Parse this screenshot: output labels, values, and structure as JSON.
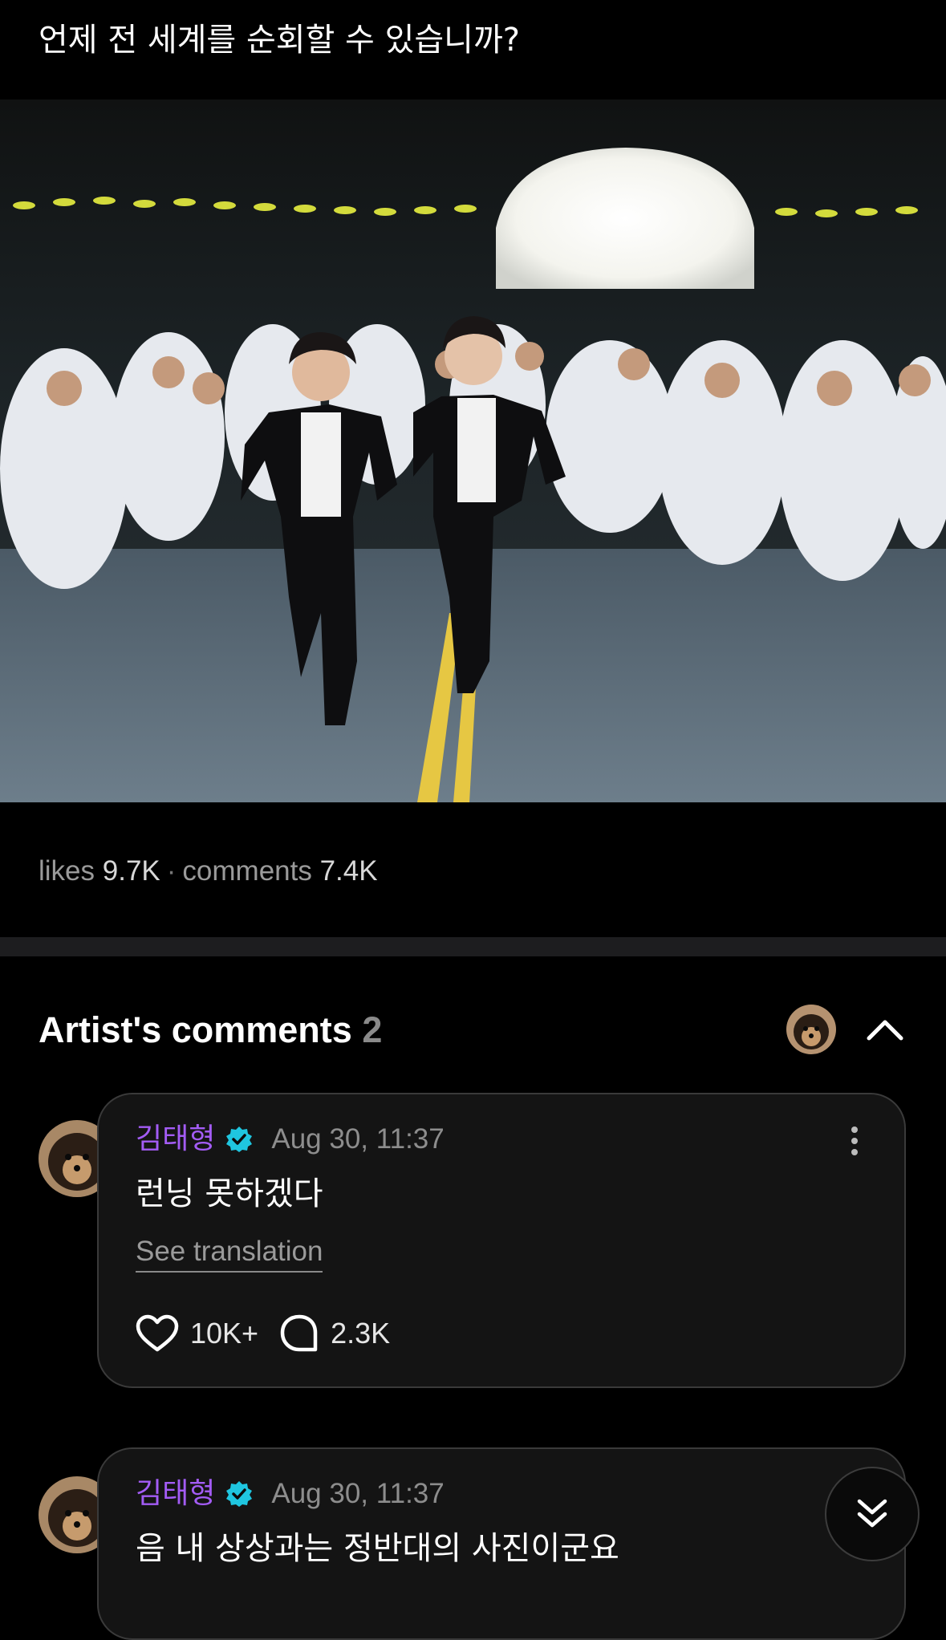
{
  "post": {
    "text": "언제 전 세계를 순회할 수 있습니까?"
  },
  "stats": {
    "likes_label": "likes",
    "likes_value": "9.7K",
    "separator": "·",
    "comments_label": "comments",
    "comments_value": "7.4K"
  },
  "artist_comments": {
    "title": "Artist's comments",
    "count": "2"
  },
  "comments": [
    {
      "author": "김태형",
      "time": "Aug 30, 11:37",
      "text": "런닝 못하겠다",
      "translate_label": "See translation",
      "likes": "10K+",
      "replies": "2.3K"
    },
    {
      "author": "김태형",
      "time": "Aug 30, 11:37",
      "text": "음 내 상상과는 정반대의 사진이군요"
    }
  ],
  "colors": {
    "background": "#000000",
    "author": "#a35cf5",
    "verified": "#1fc6e0",
    "card_bg": "#141414",
    "card_border": "#3a3a3a",
    "muted_text": "#8d8d8d"
  },
  "icons": {
    "verified": "verified-badge-icon",
    "more": "more-vertical-icon",
    "like": "heart-icon",
    "reply": "comment-bubble-icon",
    "collapse": "chevron-up-icon",
    "scroll": "double-chevron-down-icon"
  }
}
